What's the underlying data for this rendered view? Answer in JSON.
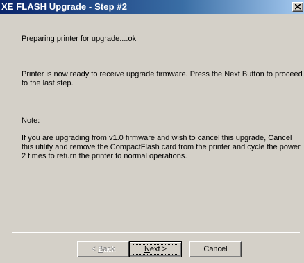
{
  "window": {
    "title": "XE FLASH Upgrade - Step #2"
  },
  "content": {
    "status": "Preparing printer for upgrade....ok",
    "ready_line1": "Printer is now ready to receive upgrade firmware.  Press the Next Button to proceed",
    "ready_line2": "to the last step.",
    "note_heading": "Note:",
    "note_line1": "If you are upgrading from v1.0 firmware and wish to cancel this upgrade,  Cancel",
    "note_line2": "this utility and remove the CompactFlash card from the printer and cycle the power",
    "note_line3": "2 times to return the printer to normal operations."
  },
  "buttons": {
    "back_prefix": "< ",
    "back_accel": "B",
    "back_rest": "ack",
    "next_accel": "N",
    "next_rest": "ext >",
    "cancel": "Cancel"
  },
  "icons": {
    "close": "close-icon"
  }
}
